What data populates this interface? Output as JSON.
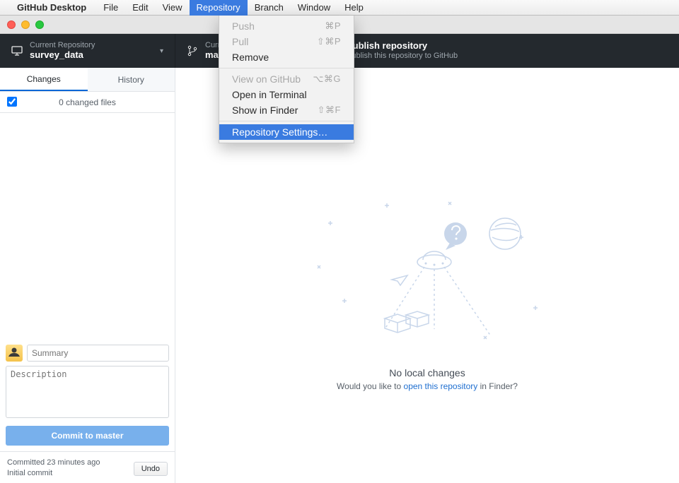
{
  "menubar": {
    "app_name": "GitHub Desktop",
    "items": [
      "File",
      "Edit",
      "View",
      "Repository",
      "Branch",
      "Window",
      "Help"
    ],
    "active_index": 3
  },
  "dropdown": {
    "push": "Push",
    "push_shortcut": "⌘P",
    "pull": "Pull",
    "pull_shortcut": "⇧⌘P",
    "remove": "Remove",
    "view_on_github": "View on GitHub",
    "view_on_github_shortcut": "⌥⌘G",
    "open_in_terminal": "Open in Terminal",
    "show_in_finder": "Show in Finder",
    "show_in_finder_shortcut": "⇧⌘F",
    "repository_settings": "Repository Settings…"
  },
  "toolbar": {
    "repo_sub": "Current Repository",
    "repo_main": "survey_data",
    "branch_sub": "Current Branch",
    "branch_main": "master",
    "publish_main": "Publish repository",
    "publish_sub": "Publish this repository to GitHub"
  },
  "sidebar": {
    "tabs": {
      "changes": "Changes",
      "history": "History"
    },
    "changed_files": "0 changed files",
    "summary_placeholder": "Summary",
    "description_placeholder": "Description",
    "commit_prefix": "Commit to ",
    "commit_branch": "master",
    "last_commit_line1": "Committed 23 minutes ago",
    "last_commit_line2": "Initial commit",
    "undo": "Undo"
  },
  "empty": {
    "title": "No local changes",
    "sub_prefix": "Would you like to ",
    "sub_link": "open this repository",
    "sub_suffix": " in Finder?"
  }
}
